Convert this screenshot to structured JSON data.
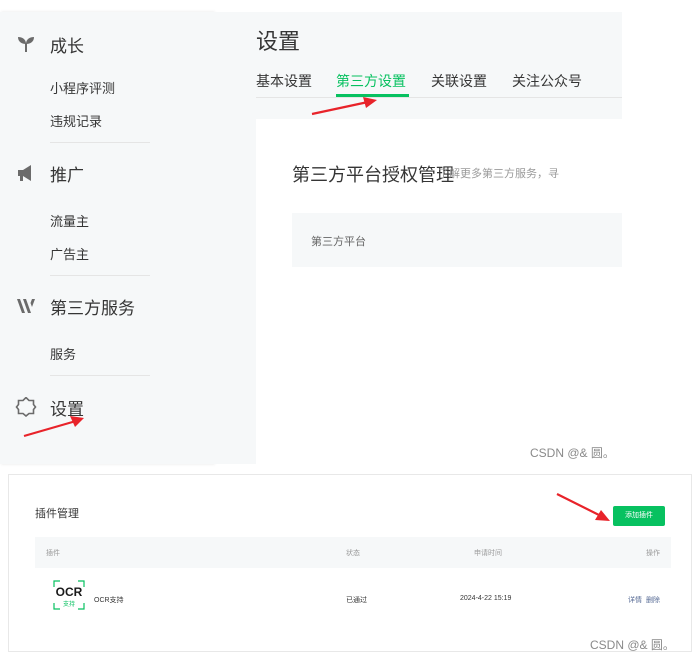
{
  "sidebar": {
    "sections": [
      {
        "icon": "sprout-icon",
        "label": "成长",
        "items": [
          "小程序评测",
          "违规记录"
        ]
      },
      {
        "icon": "megaphone-icon",
        "label": "推广",
        "items": [
          "流量主",
          "广告主"
        ]
      },
      {
        "icon": "third-party-services-icon",
        "label": "第三方服务",
        "items": [
          "服务"
        ]
      },
      {
        "icon": "gear-icon",
        "label": "设置",
        "items": []
      }
    ]
  },
  "main": {
    "title": "设置",
    "tabs": [
      "基本设置",
      "第三方设置",
      "关联设置",
      "关注公众号"
    ],
    "active_tab": "第三方设置",
    "card": {
      "title": "第三方平台授权管理",
      "desc": "了解更多第三方服务，寻",
      "platform_label": "第三方平台"
    }
  },
  "watermark_top": "CSDN @& 圆。",
  "plugins": {
    "title": "插件管理",
    "add_button": "添加插件",
    "columns": [
      "插件",
      "状态",
      "申请时间",
      "操作"
    ],
    "rows": [
      {
        "logo_text": "OCR",
        "logo_sub": "支持",
        "name": "OCR支持",
        "status": "已通过",
        "time": "2024-4-22 15:19",
        "actions": [
          "详情",
          "删除"
        ]
      }
    ]
  },
  "watermark_bottom": "CSDN @& 圆。",
  "colors": {
    "accent": "#07c160",
    "arrow": "#e8232a",
    "link": "#576b95"
  }
}
